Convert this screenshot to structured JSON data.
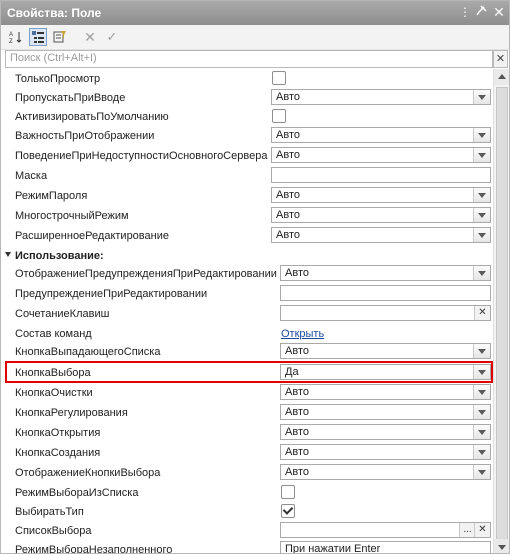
{
  "window": {
    "title": "Свойства: Поле",
    "pin_icon": "pin-icon",
    "close_icon": "close-icon"
  },
  "search": {
    "placeholder": "Поиск (Ctrl+Alt+I)",
    "clear": "✕"
  },
  "rows": {
    "r0": {
      "label": "ТолькоПросмотр"
    },
    "r1": {
      "label": "ПропускатьПриВводе",
      "value": "Авто"
    },
    "r2": {
      "label": "АктивизироватьПоУмолчанию"
    },
    "r3": {
      "label": "ВажностьПриОтображении",
      "value": "Авто"
    },
    "r4": {
      "label": "ПоведениеПриНедоступностиОсновногоСервера",
      "value": "Авто"
    },
    "r5": {
      "label": "Маска",
      "value": ""
    },
    "r6": {
      "label": "РежимПароля",
      "value": "Авто"
    },
    "r7": {
      "label": "МногострочныйРежим",
      "value": "Авто"
    },
    "r8": {
      "label": "РасширенноеРедактирование",
      "value": "Авто"
    },
    "section": {
      "label": "Использование:"
    },
    "r9": {
      "label": "ОтображениеПредупрежденияПриРедактировании",
      "value": "Авто"
    },
    "r10": {
      "label": "ПредупреждениеПриРедактировании",
      "value": ""
    },
    "r11": {
      "label": "СочетаниеКлавиш",
      "value": "",
      "button": "✕"
    },
    "r12": {
      "label": "Состав команд",
      "link": "Открыть"
    },
    "r13": {
      "label": "КнопкаВыпадающегоСписка",
      "value": "Авто"
    },
    "r14": {
      "label": "КнопкаВыбора",
      "value": "Да"
    },
    "r15": {
      "label": "КнопкаОчистки",
      "value": "Авто"
    },
    "r16": {
      "label": "КнопкаРегулирования",
      "value": "Авто"
    },
    "r17": {
      "label": "КнопкаОткрытия",
      "value": "Авто"
    },
    "r18": {
      "label": "КнопкаСоздания",
      "value": "Авто"
    },
    "r19": {
      "label": "ОтображениеКнопкиВыбора",
      "value": "Авто"
    },
    "r20": {
      "label": "РежимВыбораИзСписка"
    },
    "r21": {
      "label": "ВыбиратьТип"
    },
    "r22": {
      "label": "СписокВыбора",
      "value": "",
      "button": "...",
      "button2": "✕"
    },
    "r23": {
      "label": "РежимВыбораНезаполненного",
      "value": "При нажатии Enter"
    }
  },
  "checkboxes": {
    "r0": false,
    "r2": false,
    "r20": false,
    "r21": true
  },
  "colors": {
    "highlight": "#e00000",
    "titlebar": "#9a9a9a",
    "link": "#1b4aa0"
  }
}
